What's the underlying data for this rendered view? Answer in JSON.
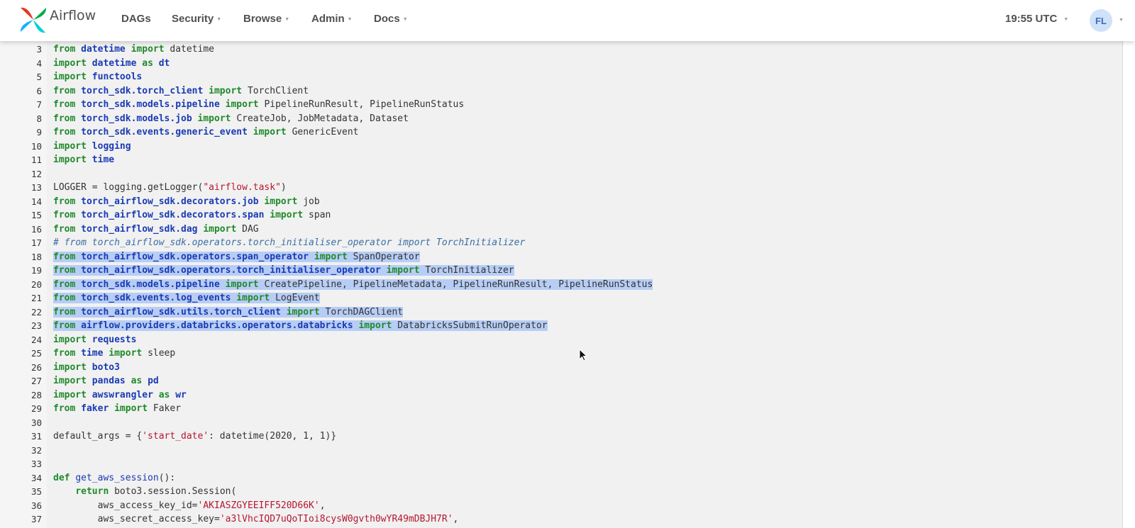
{
  "navbar": {
    "brand": "Airflow",
    "menu": [
      "DAGs",
      "Security",
      "Browse",
      "Admin",
      "Docs"
    ],
    "time": "19:55 UTC",
    "user_initials": "FL"
  },
  "colors": {
    "keyword": "#1f8a2a",
    "module": "#1a3bb3",
    "string": "#b5172f",
    "comment": "#3a6ea5",
    "selection": "#b7cdf5"
  },
  "code": {
    "lines": [
      {
        "n": "3",
        "hl": false,
        "t": [
          [
            "kw",
            "from "
          ],
          [
            "mod",
            "datetime "
          ],
          [
            "kw",
            "import "
          ],
          [
            "",
            "datetime"
          ]
        ]
      },
      {
        "n": "4",
        "hl": false,
        "t": [
          [
            "kw",
            "import "
          ],
          [
            "mod",
            "datetime "
          ],
          [
            "kw",
            "as "
          ],
          [
            "mod",
            "dt"
          ]
        ]
      },
      {
        "n": "5",
        "hl": false,
        "t": [
          [
            "kw",
            "import "
          ],
          [
            "mod",
            "functools"
          ]
        ]
      },
      {
        "n": "6",
        "hl": false,
        "t": [
          [
            "kw",
            "from "
          ],
          [
            "mod",
            "torch_sdk.torch_client "
          ],
          [
            "kw",
            "import "
          ],
          [
            "",
            "TorchClient"
          ]
        ]
      },
      {
        "n": "7",
        "hl": false,
        "t": [
          [
            "kw",
            "from "
          ],
          [
            "mod",
            "torch_sdk.models.pipeline "
          ],
          [
            "kw",
            "import "
          ],
          [
            "",
            "PipelineRunResult, PipelineRunStatus"
          ]
        ]
      },
      {
        "n": "8",
        "hl": false,
        "t": [
          [
            "kw",
            "from "
          ],
          [
            "mod",
            "torch_sdk.models.job "
          ],
          [
            "kw",
            "import "
          ],
          [
            "",
            "CreateJob, JobMetadata, Dataset"
          ]
        ]
      },
      {
        "n": "9",
        "hl": false,
        "t": [
          [
            "kw",
            "from "
          ],
          [
            "mod",
            "torch_sdk.events.generic_event "
          ],
          [
            "kw",
            "import "
          ],
          [
            "",
            "GenericEvent"
          ]
        ]
      },
      {
        "n": "10",
        "hl": false,
        "t": [
          [
            "kw",
            "import "
          ],
          [
            "mod",
            "logging"
          ]
        ]
      },
      {
        "n": "11",
        "hl": false,
        "t": [
          [
            "kw",
            "import "
          ],
          [
            "mod",
            "time"
          ]
        ]
      },
      {
        "n": "12",
        "hl": false,
        "t": []
      },
      {
        "n": "13",
        "hl": false,
        "t": [
          [
            "",
            "LOGGER = logging.getLogger("
          ],
          [
            "str",
            "\"airflow.task\""
          ],
          [
            "",
            ")"
          ]
        ]
      },
      {
        "n": "14",
        "hl": false,
        "t": [
          [
            "kw",
            "from "
          ],
          [
            "mod",
            "torch_airflow_sdk.decorators.job "
          ],
          [
            "kw",
            "import "
          ],
          [
            "",
            "job"
          ]
        ]
      },
      {
        "n": "15",
        "hl": false,
        "t": [
          [
            "kw",
            "from "
          ],
          [
            "mod",
            "torch_airflow_sdk.decorators.span "
          ],
          [
            "kw",
            "import "
          ],
          [
            "",
            "span"
          ]
        ]
      },
      {
        "n": "16",
        "hl": false,
        "t": [
          [
            "kw",
            "from "
          ],
          [
            "mod",
            "torch_airflow_sdk.dag "
          ],
          [
            "kw",
            "import "
          ],
          [
            "",
            "DAG"
          ]
        ]
      },
      {
        "n": "17",
        "hl": false,
        "t": [
          [
            "cm",
            "# from torch_airflow_sdk.operators.torch_initialiser_operator import TorchInitializer"
          ]
        ]
      },
      {
        "n": "18",
        "hl": true,
        "t": [
          [
            "kw",
            "from "
          ],
          [
            "mod",
            "torch_airflow_sdk.operators.span_operator "
          ],
          [
            "kw",
            "import "
          ],
          [
            "",
            "SpanOperator"
          ]
        ]
      },
      {
        "n": "19",
        "hl": true,
        "t": [
          [
            "kw",
            "from "
          ],
          [
            "mod",
            "torch_airflow_sdk.operators.torch_initialiser_operator "
          ],
          [
            "kw",
            "import "
          ],
          [
            "",
            "TorchInitializer"
          ]
        ]
      },
      {
        "n": "20",
        "hl": true,
        "t": [
          [
            "kw",
            "from "
          ],
          [
            "mod",
            "torch_sdk.models.pipeline "
          ],
          [
            "kw",
            "import "
          ],
          [
            "",
            "CreatePipeline, PipelineMetadata, PipelineRunResult, PipelineRunStatus"
          ]
        ]
      },
      {
        "n": "21",
        "hl": true,
        "t": [
          [
            "kw",
            "from "
          ],
          [
            "mod",
            "torch_sdk.events.log_events "
          ],
          [
            "kw",
            "import "
          ],
          [
            "",
            "LogEvent"
          ]
        ]
      },
      {
        "n": "22",
        "hl": true,
        "t": [
          [
            "kw",
            "from "
          ],
          [
            "mod",
            "torch_airflow_sdk.utils.torch_client "
          ],
          [
            "kw",
            "import "
          ],
          [
            "",
            "TorchDAGClient"
          ]
        ]
      },
      {
        "n": "23",
        "hl": true,
        "t": [
          [
            "kw",
            "from "
          ],
          [
            "mod",
            "airflow.providers.databricks.operators.databricks "
          ],
          [
            "kw",
            "import "
          ],
          [
            "",
            "DatabricksSubmitRunOperator"
          ]
        ]
      },
      {
        "n": "24",
        "hl": false,
        "t": [
          [
            "kw",
            "import "
          ],
          [
            "mod",
            "requests"
          ]
        ]
      },
      {
        "n": "25",
        "hl": false,
        "t": [
          [
            "kw",
            "from "
          ],
          [
            "mod",
            "time "
          ],
          [
            "kw",
            "import "
          ],
          [
            "",
            "sleep"
          ]
        ]
      },
      {
        "n": "26",
        "hl": false,
        "t": [
          [
            "kw",
            "import "
          ],
          [
            "mod",
            "boto3"
          ]
        ]
      },
      {
        "n": "27",
        "hl": false,
        "t": [
          [
            "kw",
            "import "
          ],
          [
            "mod",
            "pandas "
          ],
          [
            "kw",
            "as "
          ],
          [
            "mod",
            "pd"
          ]
        ]
      },
      {
        "n": "28",
        "hl": false,
        "t": [
          [
            "kw",
            "import "
          ],
          [
            "mod",
            "awswrangler "
          ],
          [
            "kw",
            "as "
          ],
          [
            "mod",
            "wr"
          ]
        ]
      },
      {
        "n": "29",
        "hl": false,
        "t": [
          [
            "kw",
            "from "
          ],
          [
            "mod",
            "faker "
          ],
          [
            "kw",
            "import "
          ],
          [
            "",
            "Faker"
          ]
        ]
      },
      {
        "n": "30",
        "hl": false,
        "t": []
      },
      {
        "n": "31",
        "hl": false,
        "t": [
          [
            "",
            "default_args = {"
          ],
          [
            "str",
            "'start_date'"
          ],
          [
            "",
            ": datetime(2020, 1, 1)}"
          ]
        ]
      },
      {
        "n": "32",
        "hl": false,
        "t": []
      },
      {
        "n": "33",
        "hl": false,
        "t": []
      },
      {
        "n": "34",
        "hl": false,
        "t": [
          [
            "kw",
            "def "
          ],
          [
            "fn",
            "get_aws_session"
          ],
          [
            "",
            "():"
          ]
        ]
      },
      {
        "n": "35",
        "hl": false,
        "t": [
          [
            "",
            "    "
          ],
          [
            "kw",
            "return "
          ],
          [
            "",
            "boto3.session.Session("
          ]
        ]
      },
      {
        "n": "36",
        "hl": false,
        "t": [
          [
            "",
            "        aws_access_key_id="
          ],
          [
            "str",
            "'AKIASZGYEEIFF520D66K'"
          ],
          [
            "",
            ","
          ]
        ]
      },
      {
        "n": "37",
        "hl": false,
        "t": [
          [
            "",
            "        aws_secret_access_key="
          ],
          [
            "str",
            "'a3lVhcIQD7uQoTIoi8cysW0gvth0wYR49mDBJH7R'"
          ],
          [
            "",
            ","
          ]
        ]
      }
    ]
  }
}
